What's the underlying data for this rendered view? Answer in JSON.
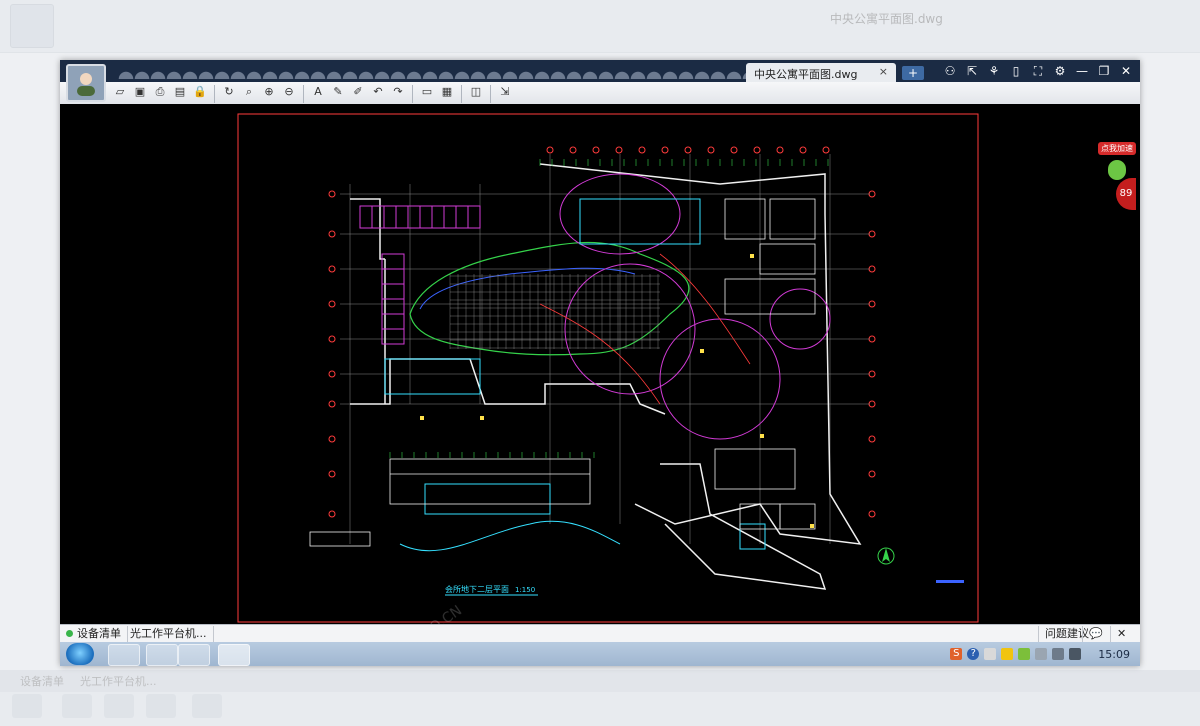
{
  "window": {
    "doc_tab_title": "中央公寓平面图.dwg",
    "close_tab": "×",
    "new_tab": "+",
    "controls": [
      "⚇",
      "⇱",
      "⚘",
      "▯",
      "⛶",
      "⚙",
      "—",
      "❐",
      "✕"
    ]
  },
  "toolbar": {
    "icons": [
      "open-icon",
      "save-icon",
      "print-icon",
      "export-pdf-icon",
      "lock-icon",
      "rotate-icon",
      "zoom-window-icon",
      "zoom-in-icon",
      "zoom-out-icon",
      "text-icon",
      "pencil-icon",
      "marker-icon",
      "undo-icon",
      "redo-icon",
      "measure-icon",
      "measure-area-icon",
      "layers-icon",
      "export-icon"
    ]
  },
  "badge": {
    "label": "点我加速",
    "number": "89"
  },
  "drawing": {
    "title": "会所地下二层平面",
    "scale": "1:150",
    "watermark": "PHOTO.CN"
  },
  "statusbar": {
    "device_list": "设备清单",
    "app_item": "光工作平台机...",
    "feedback": "问题建议",
    "chat_icon": "💬",
    "close": "✕"
  },
  "taskbar": {
    "clock": "15:09",
    "tray_input": "S",
    "tray_help": "?"
  },
  "colors": {
    "titlebar": "#1b2b44",
    "canvas": "#000000",
    "cad_red": "#ff3b3b",
    "cad_green": "#35d24a",
    "cad_cyan": "#35e0ff",
    "cad_magenta": "#d23bd6",
    "cad_white": "#f0f0f0",
    "cad_yellow": "#ffe14a",
    "cad_blue": "#3b63ff"
  }
}
